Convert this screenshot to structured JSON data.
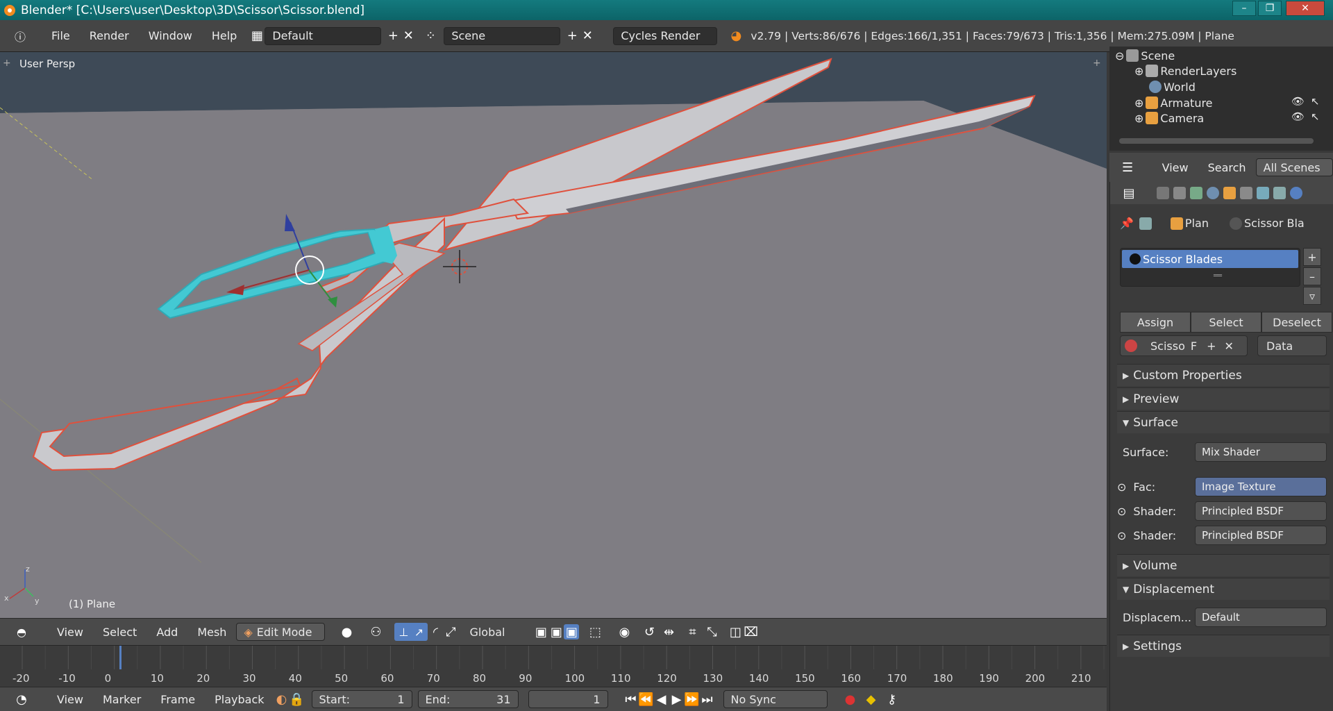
{
  "window": {
    "title": "Blender* [C:\\Users\\user\\Desktop\\3D\\Scissor\\Scissor.blend]",
    "min": "–",
    "max": "❐",
    "close": "✕"
  },
  "info": {
    "menus": [
      "File",
      "Render",
      "Window",
      "Help"
    ],
    "layout": "Default",
    "scene": "Scene",
    "engine": "Cycles Render",
    "stats": "v2.79 | Verts:86/676 | Edges:166/1,351 | Faces:79/673 | Tris:1,356 | Mem:275.09M | Plane",
    "add": "+",
    "remove": "✕"
  },
  "viewport": {
    "view_name": "User Persp",
    "object_label": "(1) Plane",
    "axis_z": "z",
    "axis_x": "x",
    "axis_y": "y"
  },
  "vp_header": {
    "menus": [
      "View",
      "Select",
      "Add",
      "Mesh"
    ],
    "mode": "Edit Mode",
    "orientation": "Global"
  },
  "timeline": {
    "ticks": [
      "-20",
      "-10",
      "0",
      "10",
      "20",
      "30",
      "40",
      "50",
      "60",
      "70",
      "80",
      "90",
      "100",
      "110",
      "120",
      "130",
      "140",
      "150",
      "160",
      "170",
      "180",
      "190",
      "200",
      "210"
    ],
    "current": 0
  },
  "tl_header": {
    "menus": [
      "View",
      "Marker",
      "Frame",
      "Playback"
    ],
    "start_label": "Start:",
    "start": "1",
    "end_label": "End:",
    "end": "31",
    "frame": "1",
    "sync": "No Sync"
  },
  "outliner": {
    "items": [
      {
        "label": "Scene",
        "icon": "scene-icon"
      },
      {
        "label": "RenderLayers",
        "icon": "renderlayers-icon"
      },
      {
        "label": "World",
        "icon": "world-icon"
      },
      {
        "label": "Armature",
        "icon": "armature-icon"
      },
      {
        "label": "Camera",
        "icon": "camera-icon"
      }
    ]
  },
  "outliner_header": {
    "view": "View",
    "search": "Search",
    "filter": "All Scenes"
  },
  "properties": {
    "breadcrumb": {
      "object": "Plan",
      "material": "Scissor Bla"
    },
    "slot": "Scissor Blades",
    "buttons": {
      "assign": "Assign",
      "select": "Select",
      "deselect": "Deselect"
    },
    "material_name": "Scisso",
    "fake": "F",
    "link": "Data",
    "sections": {
      "custom": "Custom Properties",
      "preview": "Preview",
      "surface": "Surface",
      "volume": "Volume",
      "displacement": "Displacement",
      "settings": "Settings"
    },
    "surface": {
      "surface_label": "Surface:",
      "surface_val": "Mix Shader",
      "fac_label": "Fac:",
      "fac_val": "Image Texture",
      "shader1_label": "Shader:",
      "shader1_val": "Principled BSDF",
      "shader2_label": "Shader:",
      "shader2_val": "Principled BSDF"
    },
    "disp": {
      "label": "Displacem...",
      "val": "Default"
    }
  },
  "colors": {
    "accent": "#5680c2",
    "wire": "#e0503c",
    "select": "#3fc8d2"
  }
}
